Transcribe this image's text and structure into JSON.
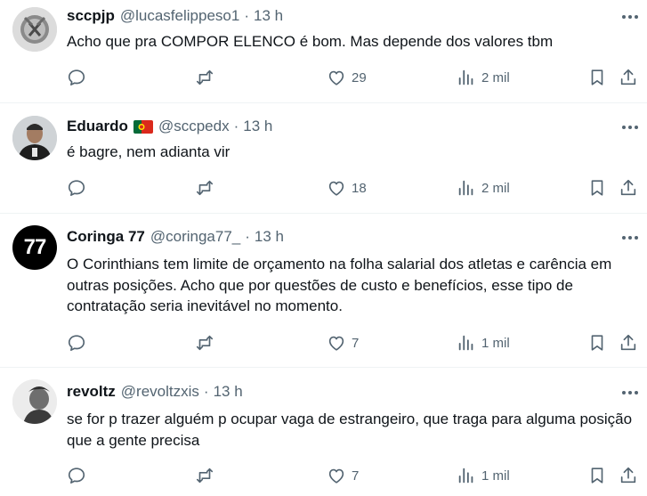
{
  "tweets": [
    {
      "name": "sccpjp",
      "handle": "@lucasfelippeso1",
      "dot": "·",
      "time": "13 h",
      "flag": false,
      "text": "Acho que pra COMPOR ELENCO é bom. Mas depende dos valores tbm",
      "likes": "29",
      "views": "2 mil"
    },
    {
      "name": "Eduardo",
      "handle": "@sccpedx",
      "dot": "·",
      "time": "13 h",
      "flag": true,
      "text": "é bagre, nem adianta vir",
      "likes": "18",
      "views": "2 mil"
    },
    {
      "name": "Coringa 77",
      "handle": "@coringa77_",
      "dot": "·",
      "time": "13 h",
      "flag": false,
      "avatar_text": "77",
      "text": "O Corinthians tem limite de orçamento na folha salarial dos atletas e carência em outras posições. Acho que por questões de custo e benefícios, esse tipo de contratação seria inevitável no momento.",
      "likes": "7",
      "views": "1 mil"
    },
    {
      "name": "revoltz",
      "handle": "@revoltzxis",
      "dot": "·",
      "time": "13 h",
      "flag": false,
      "text": "se for p trazer alguém p ocupar vaga de estrangeiro, que traga para alguma posição que a gente precisa",
      "likes": "7",
      "views": "1 mil"
    }
  ],
  "colors": {
    "text": "#0f1419",
    "secondary": "#536471",
    "separator": "#eff3f4",
    "flag_green": "#046a38",
    "flag_red": "#da291c"
  }
}
